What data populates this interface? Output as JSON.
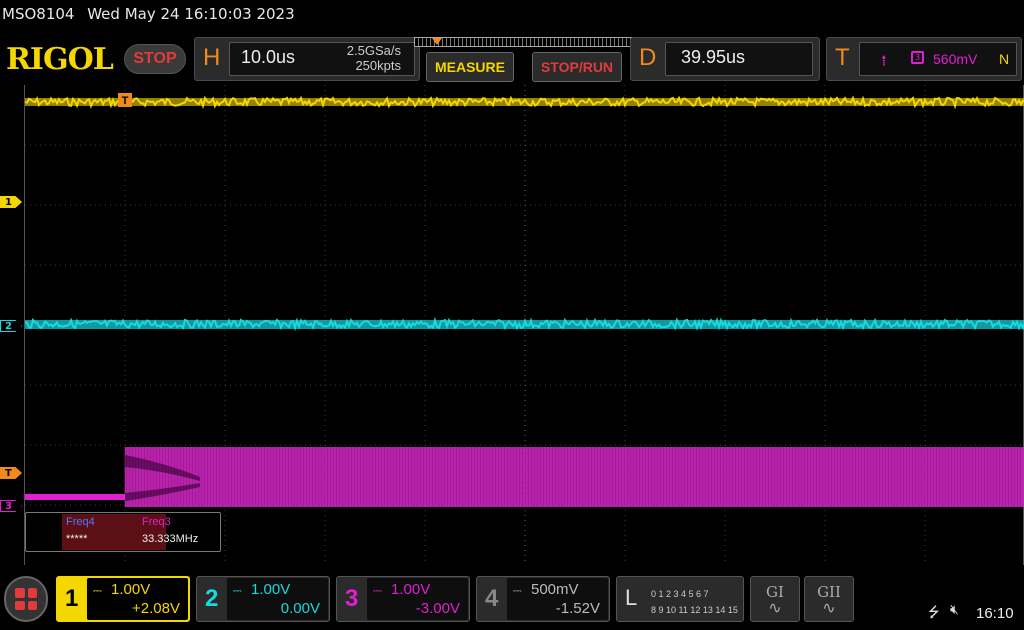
{
  "header": {
    "model": "MSO8104",
    "datetime": "Wed May 24 16:10:03 2023"
  },
  "toolbar": {
    "logo": "RIGOL",
    "run_state": "STOP",
    "horizontal": {
      "letter": "H",
      "timebase": "10.0us",
      "sample_rate": "2.5GSa/s",
      "memory_depth": "250kpts"
    },
    "measure_label": "MEASURE",
    "stoprun_label": "STOP/RUN",
    "delay": {
      "letter": "D",
      "value": "39.95us"
    },
    "trigger": {
      "letter": "T",
      "edge_symbol": "⭫",
      "source": "3",
      "level": "560mV",
      "mode": "N"
    }
  },
  "markers": {
    "ch1": "1",
    "ch2": "2",
    "trigger": "T",
    "ch3": "3",
    "top_trigger": "T"
  },
  "measurement": {
    "items": [
      {
        "name": "Freq4",
        "value": "*****"
      },
      {
        "name": "Freq3",
        "value": "33.333MHz"
      }
    ]
  },
  "channels": [
    {
      "num": "1",
      "coupling": "⎓",
      "scale": "1.00V",
      "offset": "+2.08V"
    },
    {
      "num": "2",
      "coupling": "⎓",
      "scale": "1.00V",
      "offset": "0.00V"
    },
    {
      "num": "3",
      "coupling": "⎓",
      "scale": "1.00V",
      "offset": "-3.00V"
    },
    {
      "num": "4",
      "coupling": "⎓",
      "scale": "500mV",
      "offset": "-1.52V"
    }
  ],
  "logic": {
    "letter": "L",
    "row1": "0 1 2 3   4 5 6 7",
    "row2": "8 9 10 11 12 13 14 15"
  },
  "generators": [
    {
      "label": "GI",
      "wave": "∿"
    },
    {
      "label": "GII",
      "wave": "∿"
    }
  ],
  "status": {
    "usb_icon": "usb-icon",
    "sound_icon": "sound-muted-icon",
    "time": "16:10"
  },
  "colors": {
    "ch1": "#f4d600",
    "ch2": "#18d8e0",
    "ch3": "#e020d0",
    "ch4": "#4d7cff",
    "accent": "#f08a1c",
    "stop": "#e23b3b"
  },
  "waveforms": {
    "ch1": "flat high-level trace with noise",
    "ch2": "flat trace at 0 V with noise",
    "ch3": "low before trigger, then 33.333 MHz clock burst filling band"
  }
}
